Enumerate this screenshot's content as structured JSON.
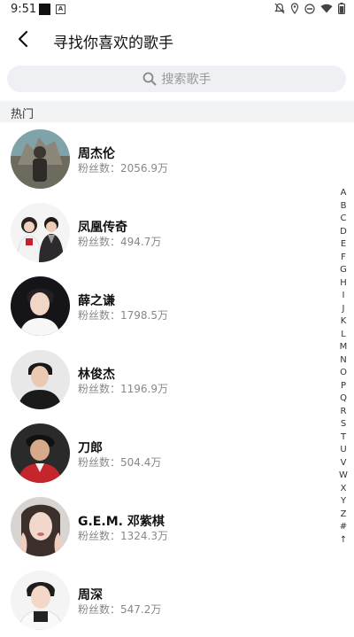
{
  "status_bar": {
    "time": "9:51",
    "notification_icon": "a-icon"
  },
  "header": {
    "title": "寻找你喜欢的歌手"
  },
  "search": {
    "placeholder": "搜索歌手"
  },
  "section": {
    "label": "热门"
  },
  "singers": [
    {
      "name": "周杰伦",
      "fans": "粉丝数：2056.9万"
    },
    {
      "name": "凤凰传奇",
      "fans": "粉丝数：494.7万"
    },
    {
      "name": "薛之谦",
      "fans": "粉丝数：1798.5万"
    },
    {
      "name": "林俊杰",
      "fans": "粉丝数：1196.9万"
    },
    {
      "name": "刀郎",
      "fans": "粉丝数：504.4万"
    },
    {
      "name": "G.E.M. 邓紫棋",
      "fans": "粉丝数：1324.3万"
    },
    {
      "name": "周深",
      "fans": "粉丝数：547.2万"
    }
  ],
  "alphabet": [
    "A",
    "B",
    "C",
    "D",
    "E",
    "F",
    "G",
    "H",
    "I",
    "J",
    "K",
    "L",
    "M",
    "N",
    "O",
    "P",
    "Q",
    "R",
    "S",
    "T",
    "U",
    "V",
    "W",
    "X",
    "Y",
    "Z",
    "#",
    "↑"
  ]
}
